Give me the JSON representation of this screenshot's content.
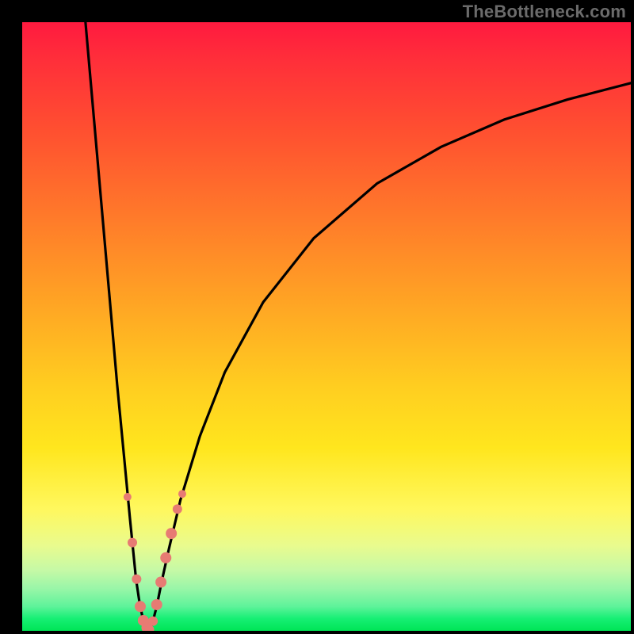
{
  "attribution": "TheBottleneck.com",
  "colors": {
    "curve": "#000000",
    "dot": "#e77b73",
    "background_frame": "#000000"
  },
  "chart_data": {
    "type": "line",
    "title": "",
    "xlabel": "",
    "ylabel": "",
    "xlim": [
      0,
      100
    ],
    "ylim": [
      0,
      100
    ],
    "grid": false,
    "note": "Axes have no tick labels in the source image; x and y are normalized 0–100 left→right and bottom→top. Values estimated from pixel positions.",
    "series": [
      {
        "name": "left-branch",
        "type": "line",
        "x": [
          10.4,
          12.5,
          14.6,
          15.6,
          16.7,
          17.7,
          18.7,
          19.3,
          19.8,
          20.2,
          20.5,
          20.8
        ],
        "y": [
          100,
          76,
          52,
          40.5,
          29,
          18.5,
          8.5,
          4.5,
          2.1,
          1.0,
          0.4,
          0.1
        ]
      },
      {
        "name": "right-branch",
        "type": "line",
        "x": [
          20.8,
          21.4,
          22.1,
          22.9,
          24.0,
          26.0,
          29.2,
          33.3,
          39.6,
          47.9,
          58.3,
          68.8,
          79.2,
          89.6,
          100
        ],
        "y": [
          0.1,
          1.3,
          4.0,
          8.0,
          13.0,
          21.5,
          32.0,
          42.5,
          54.0,
          64.5,
          73.5,
          79.5,
          84.0,
          87.3,
          90.0
        ]
      }
    ],
    "scatter": {
      "name": "highlight-dots",
      "type": "scatter",
      "color": "#e77b73",
      "points": [
        {
          "x": 17.3,
          "y": 22.0,
          "r": 5
        },
        {
          "x": 18.1,
          "y": 14.5,
          "r": 6
        },
        {
          "x": 18.8,
          "y": 8.5,
          "r": 6
        },
        {
          "x": 19.4,
          "y": 4.0,
          "r": 7
        },
        {
          "x": 19.9,
          "y": 1.7,
          "r": 7
        },
        {
          "x": 20.5,
          "y": 0.5,
          "r": 7
        },
        {
          "x": 20.9,
          "y": 0.2,
          "r": 6
        },
        {
          "x": 21.5,
          "y": 1.6,
          "r": 6
        },
        {
          "x": 22.1,
          "y": 4.3,
          "r": 7
        },
        {
          "x": 22.8,
          "y": 8.0,
          "r": 7
        },
        {
          "x": 23.6,
          "y": 12.0,
          "r": 7
        },
        {
          "x": 24.5,
          "y": 16.0,
          "r": 7
        },
        {
          "x": 25.5,
          "y": 20.0,
          "r": 6
        },
        {
          "x": 26.3,
          "y": 22.5,
          "r": 5
        }
      ]
    }
  }
}
